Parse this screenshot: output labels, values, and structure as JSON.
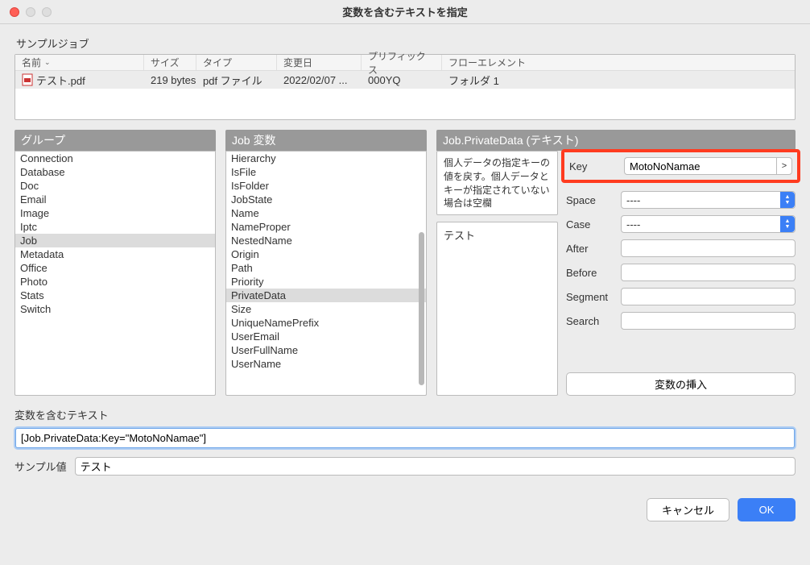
{
  "window": {
    "title": "変数を含むテキストを指定"
  },
  "sampleJob": {
    "label": "サンプルジョブ",
    "headers": {
      "name": "名前",
      "size": "サイズ",
      "type": "タイプ",
      "date": "変更日",
      "prefix": "プリフィックス",
      "flow": "フローエレメント"
    },
    "rows": [
      {
        "name": "テスト.pdf",
        "size": "219 bytes",
        "type": "pdf ファイル",
        "date": "2022/02/07 ...",
        "prefix": "000YQ",
        "flow": "フォルダ 1"
      }
    ]
  },
  "groupPanel": {
    "title": "グループ",
    "items": [
      "Connection",
      "Database",
      "Doc",
      "Email",
      "Image",
      "Iptc",
      "Job",
      "Metadata",
      "Office",
      "Photo",
      "Stats",
      "Switch"
    ],
    "selected": "Job"
  },
  "varsPanel": {
    "title": "Job 変数",
    "items": [
      "Hierarchy",
      "IsFile",
      "IsFolder",
      "JobState",
      "Name",
      "NameProper",
      "NestedName",
      "Origin",
      "Path",
      "Priority",
      "PrivateData",
      "Size",
      "UniqueNamePrefix",
      "UserEmail",
      "UserFullName",
      "UserName"
    ],
    "selected": "PrivateData"
  },
  "detailsPanel": {
    "title": "Job.PrivateData (テキスト)",
    "description": "個人データの指定キーの値を戻す。個人データとキーが指定されていない場合は空欄",
    "sampleValue": "テスト",
    "form": {
      "keyLabel": "Key",
      "keyValue": "MotoNoNamae",
      "spaceLabel": "Space",
      "spaceValue": "----",
      "caseLabel": "Case",
      "caseValue": "----",
      "afterLabel": "After",
      "afterValue": "",
      "beforeLabel": "Before",
      "beforeValue": "",
      "segmentLabel": "Segment",
      "segmentValue": "",
      "searchLabel": "Search",
      "searchValue": ""
    },
    "insertButton": "変数の挿入"
  },
  "bottom": {
    "textLabel": "変数を含むテキスト",
    "textValue": "[Job.PrivateData:Key=\"MotoNoNamae\"]",
    "sampleLabel": "サンプル値",
    "sampleValue": "テスト"
  },
  "footer": {
    "cancel": "キャンセル",
    "ok": "OK"
  }
}
